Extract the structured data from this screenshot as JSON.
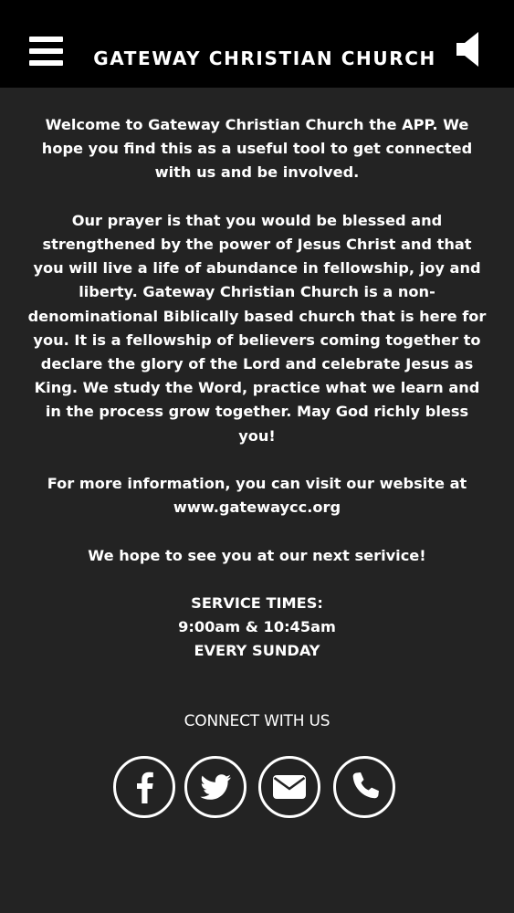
{
  "header": {
    "title": "GATEWAY CHRISTIAN CHURCH",
    "menu_icon": "hamburger-menu-icon",
    "audio_icon": "speaker-icon"
  },
  "content": {
    "welcome": "Welcome to Gateway Christian Church the APP. We hope you find this as a useful tool to get connected with us and be involved.",
    "prayer": "Our prayer is that you would be blessed and strengthened by the power of Jesus Christ and that you will live a life of abundance in fellowship, joy and liberty. Gateway Christian Church is a non-denominational Biblically based church that is here for you. It is a fellowship of believers coming together to declare the glory of the Lord and celebrate Jesus as King. We study the Word, practice what we learn and in the process grow together. May God richly bless you!",
    "info_prefix": "For more information, you can visit our website at",
    "website": "www.gatewaycc.org",
    "hope": "We hope to see you at our next serivice!",
    "service_times_label": "SERVICE TIMES:",
    "service_times": "9:00am & 10:45am",
    "service_day": "EVERY SUNDAY"
  },
  "connect": {
    "label": "CONNECT WITH US",
    "icons": [
      "facebook-icon",
      "twitter-icon",
      "email-icon",
      "phone-icon"
    ]
  },
  "colors": {
    "header_bg": "#000000",
    "page_bg": "#232323",
    "text": "#ffffff"
  }
}
